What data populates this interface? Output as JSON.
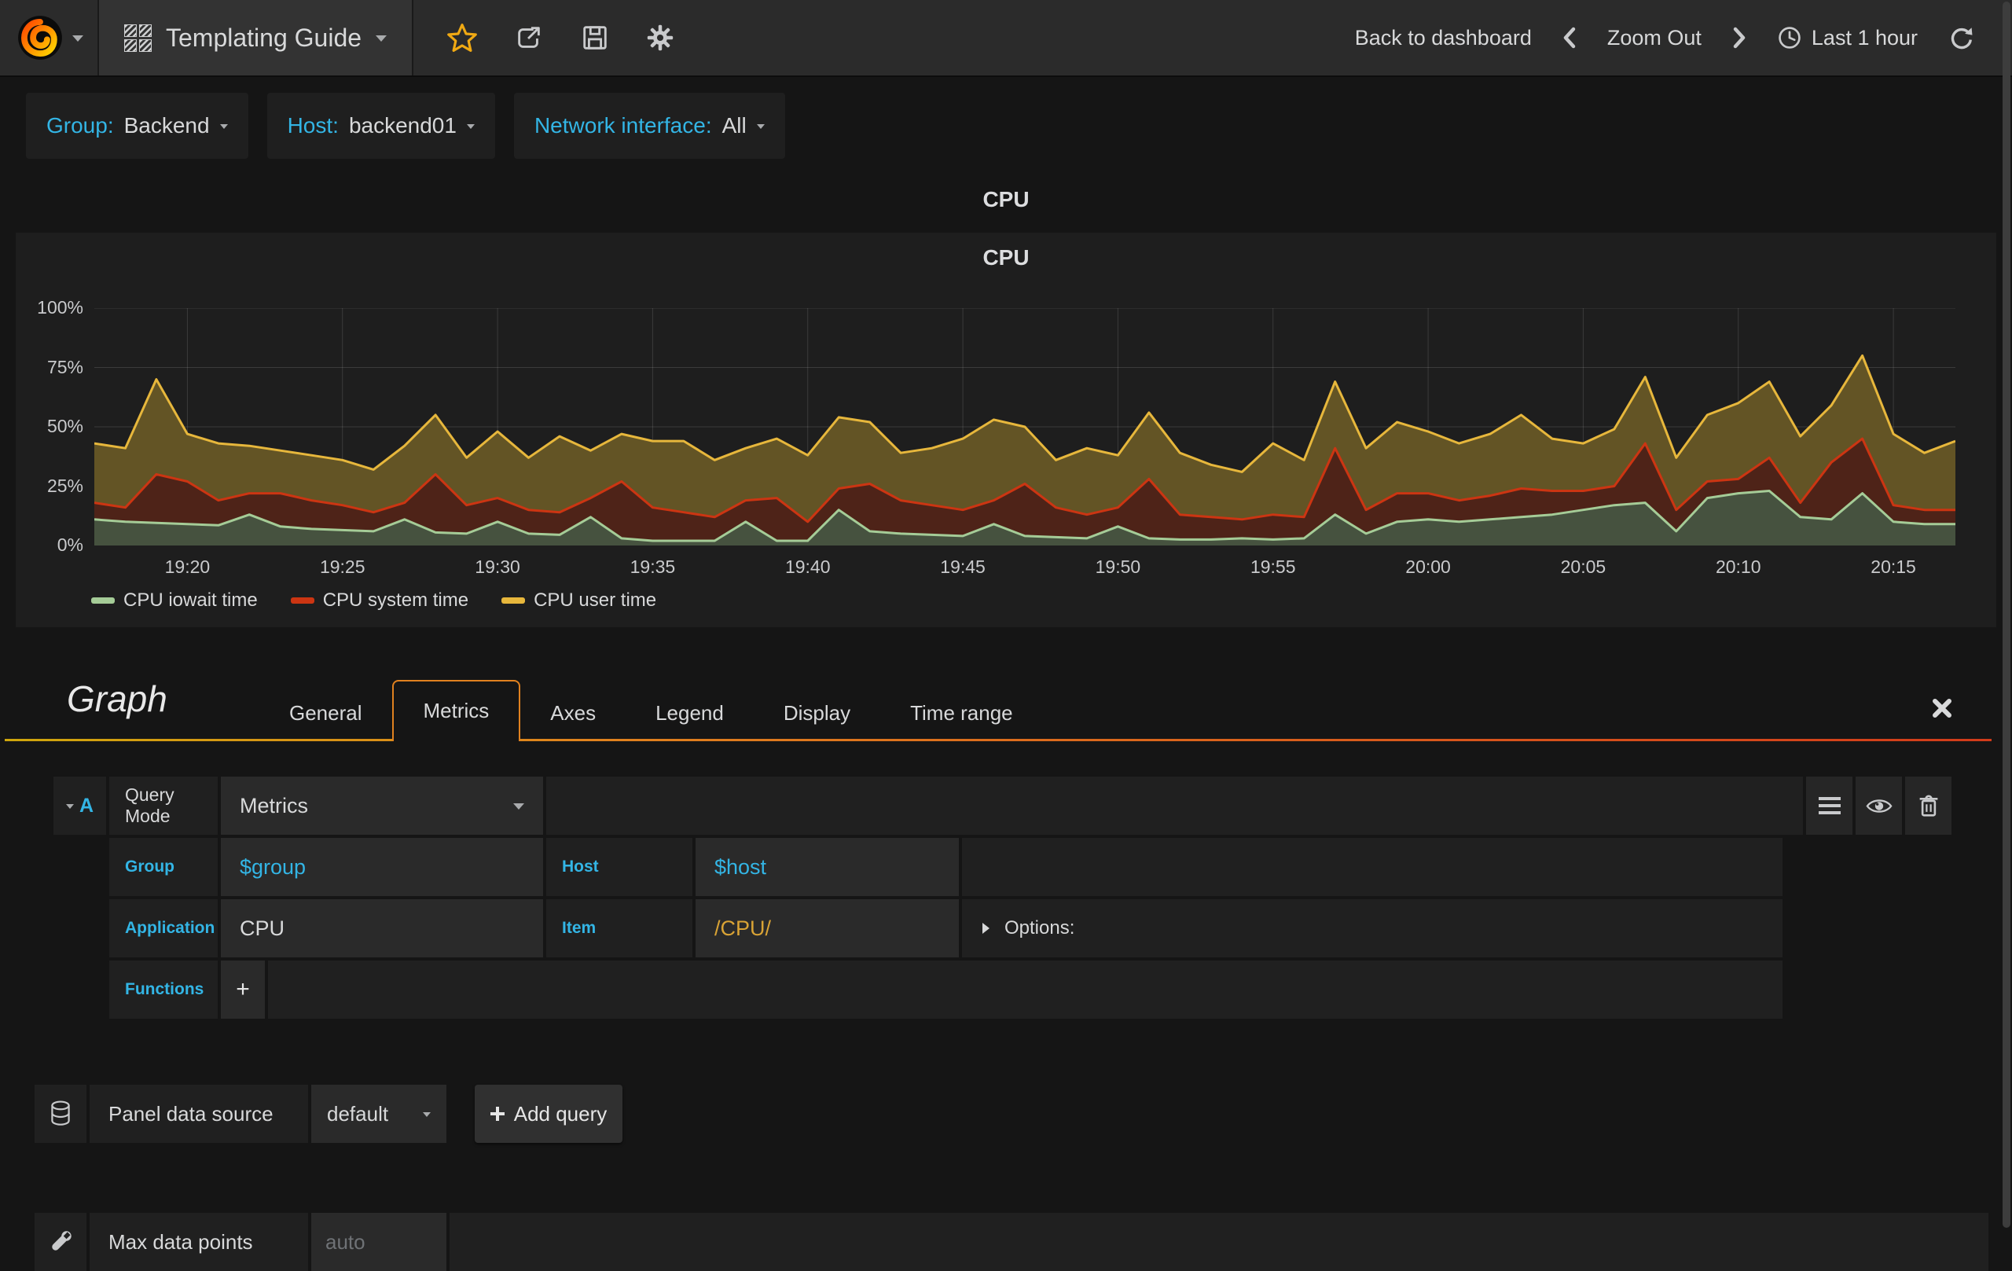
{
  "nav": {
    "dashboard_title": "Templating Guide",
    "back_to_dashboard_label": "Back to dashboard",
    "zoom_out_label": "Zoom Out",
    "time_range_label": "Last 1 hour"
  },
  "variables": [
    {
      "label": "Group:",
      "value": "Backend"
    },
    {
      "label": "Host:",
      "value": "backend01"
    },
    {
      "label": "Network interface:",
      "value": "All"
    }
  ],
  "panel": {
    "header_title": "CPU",
    "title": "CPU"
  },
  "chart_data": {
    "type": "area",
    "stacked": true,
    "title": "CPU",
    "x_start": "19:17",
    "x_end": "20:17",
    "minutes_per_point": 1,
    "x_ticks": [
      "19:20",
      "19:25",
      "19:30",
      "19:35",
      "19:40",
      "19:45",
      "19:50",
      "19:55",
      "20:00",
      "20:05",
      "20:10",
      "20:15"
    ],
    "x_tick_minutes": [
      3,
      8,
      13,
      18,
      23,
      28,
      33,
      38,
      43,
      48,
      53,
      58
    ],
    "y_ticks": [
      "0%",
      "25%",
      "50%",
      "75%",
      "100%"
    ],
    "y_grid_values": [
      0,
      25,
      50,
      75,
      100
    ],
    "ylim": [
      0,
      100
    ],
    "unit": "percent",
    "grid": true,
    "legend_position": "bottom-left",
    "series": [
      {
        "name": "CPU iowait time",
        "color": "#A5CC97",
        "fill": "#46523f",
        "values": [
          11,
          10,
          9.5,
          9,
          8.5,
          13,
          8,
          7,
          6.5,
          6,
          11,
          5.5,
          5,
          10,
          5,
          4.5,
          12,
          3,
          2,
          2,
          2,
          10,
          2,
          2,
          15,
          6,
          5,
          4.5,
          4,
          9,
          4,
          3.5,
          3,
          8,
          3,
          2.5,
          2.5,
          3,
          2.5,
          3,
          13,
          5,
          10,
          11,
          10,
          11,
          12,
          13,
          15,
          17,
          18,
          6,
          20,
          22,
          23,
          12,
          11,
          22,
          10,
          9,
          9
        ]
      },
      {
        "name": "CPU system time",
        "color": "#CC3512",
        "fill": "#4e2318",
        "values": [
          7,
          6,
          20.5,
          18,
          10.5,
          9,
          14,
          12,
          10.5,
          8,
          7,
          24.5,
          12,
          10,
          10,
          9.5,
          8,
          24,
          14,
          12,
          10,
          9,
          18,
          8,
          9,
          20,
          14,
          12.5,
          11,
          10,
          22,
          12.5,
          10,
          8,
          25,
          10.5,
          9.5,
          8,
          10.5,
          9,
          28,
          10,
          12,
          11,
          9,
          10,
          12,
          10,
          8,
          8,
          25,
          9,
          7,
          6,
          14,
          6,
          24,
          23,
          7,
          6,
          6
        ]
      },
      {
        "name": "CPU user time",
        "color": "#E7B73C",
        "fill": "#635425",
        "values": [
          25,
          25,
          40,
          20,
          24,
          20,
          18,
          19,
          19,
          18,
          24,
          25,
          20,
          28,
          22,
          32,
          20,
          20,
          28,
          30,
          24,
          22,
          25,
          28,
          30,
          26,
          20,
          24,
          30,
          34,
          24,
          20,
          28,
          22,
          28,
          26,
          22,
          20,
          30,
          24,
          28,
          26,
          30,
          26,
          24,
          26,
          31,
          22,
          20,
          24,
          28,
          22,
          28,
          32,
          32,
          28,
          24,
          35,
          30,
          24,
          29
        ]
      }
    ]
  },
  "editor": {
    "panel_type": "Graph",
    "tabs": [
      {
        "label": "General",
        "active": false
      },
      {
        "label": "Metrics",
        "active": true
      },
      {
        "label": "Axes",
        "active": false
      },
      {
        "label": "Legend",
        "active": false
      },
      {
        "label": "Display",
        "active": false
      },
      {
        "label": "Time range",
        "active": false
      }
    ],
    "query": {
      "ref": "A",
      "query_mode_label": "Query Mode",
      "query_mode_value": "Metrics",
      "group_label": "Group",
      "group_value": "$group",
      "host_label": "Host",
      "host_value": "$host",
      "application_label": "Application",
      "application_value": "CPU",
      "item_label": "Item",
      "item_value": "/CPU/",
      "options_label": "Options:",
      "functions_label": "Functions",
      "add_function_label": "+"
    },
    "datasource": {
      "label": "Panel data source",
      "value": "default",
      "add_query_label": "Add query"
    },
    "footer": {
      "max_data_points_label": "Max data points",
      "max_data_points_placeholder": "auto"
    }
  },
  "colors": {
    "accent_cyan": "#33b5e5",
    "tab_orange": "#e0811f",
    "star_yellow": "#f0a913",
    "item_orange": "#d9a335",
    "nav_bg": "#2b2b2b",
    "panel_bg": "#1e1e1e"
  }
}
